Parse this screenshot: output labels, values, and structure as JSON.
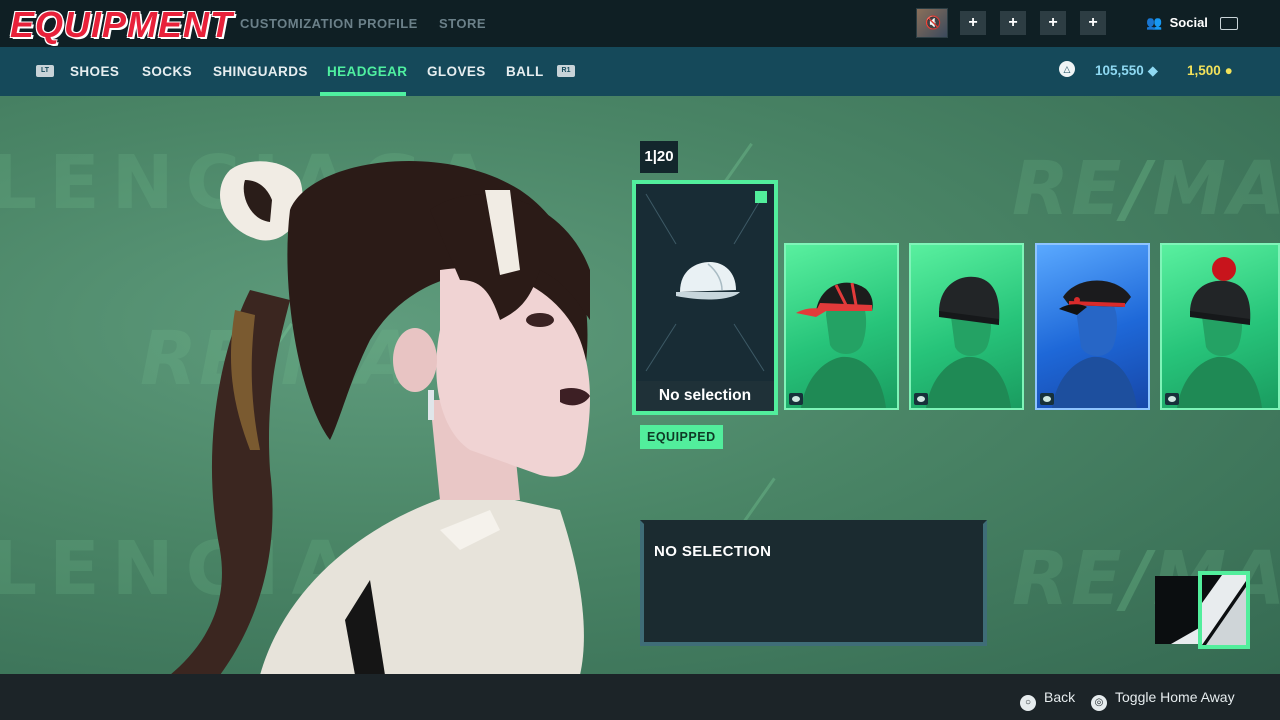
{
  "header": {
    "title": "EQUIPMENT",
    "tabs": [
      "CUSTOMIZATION",
      "PROFILE",
      "STORE"
    ],
    "social_label": "Social"
  },
  "categories": {
    "left_shoulder": "LT",
    "right_shoulder": "R1",
    "items": [
      "SHOES",
      "SOCKS",
      "SHINGUARDS",
      "HEADGEAR",
      "GLOVES",
      "BALL"
    ],
    "active": "HEADGEAR"
  },
  "currency": {
    "gems": "105,550",
    "coins": "1,500"
  },
  "background": {
    "brand_word": "REMATCH",
    "brand_short": "RE/MA",
    "wordmark": "LENCIAGA"
  },
  "selection": {
    "counter": "1|20",
    "current_label": "No selection",
    "equipped_badge": "EQUIPPED"
  },
  "items": [
    {
      "name": "red-black cap",
      "rarity": "green"
    },
    {
      "name": "black beanie",
      "rarity": "green"
    },
    {
      "name": "black peaked cap",
      "rarity": "blue"
    },
    {
      "name": "black bobble beanie",
      "rarity": "green"
    }
  ],
  "details": {
    "title": "NO SELECTION"
  },
  "footer": {
    "back_label": "Back",
    "toggle_label": "Toggle Home Away"
  },
  "colors": {
    "accent": "#52ee9c",
    "title_red": "#e8213a",
    "category_bar": "#15495a",
    "gem": "#8fd9f2",
    "coin": "#f3e25a"
  }
}
